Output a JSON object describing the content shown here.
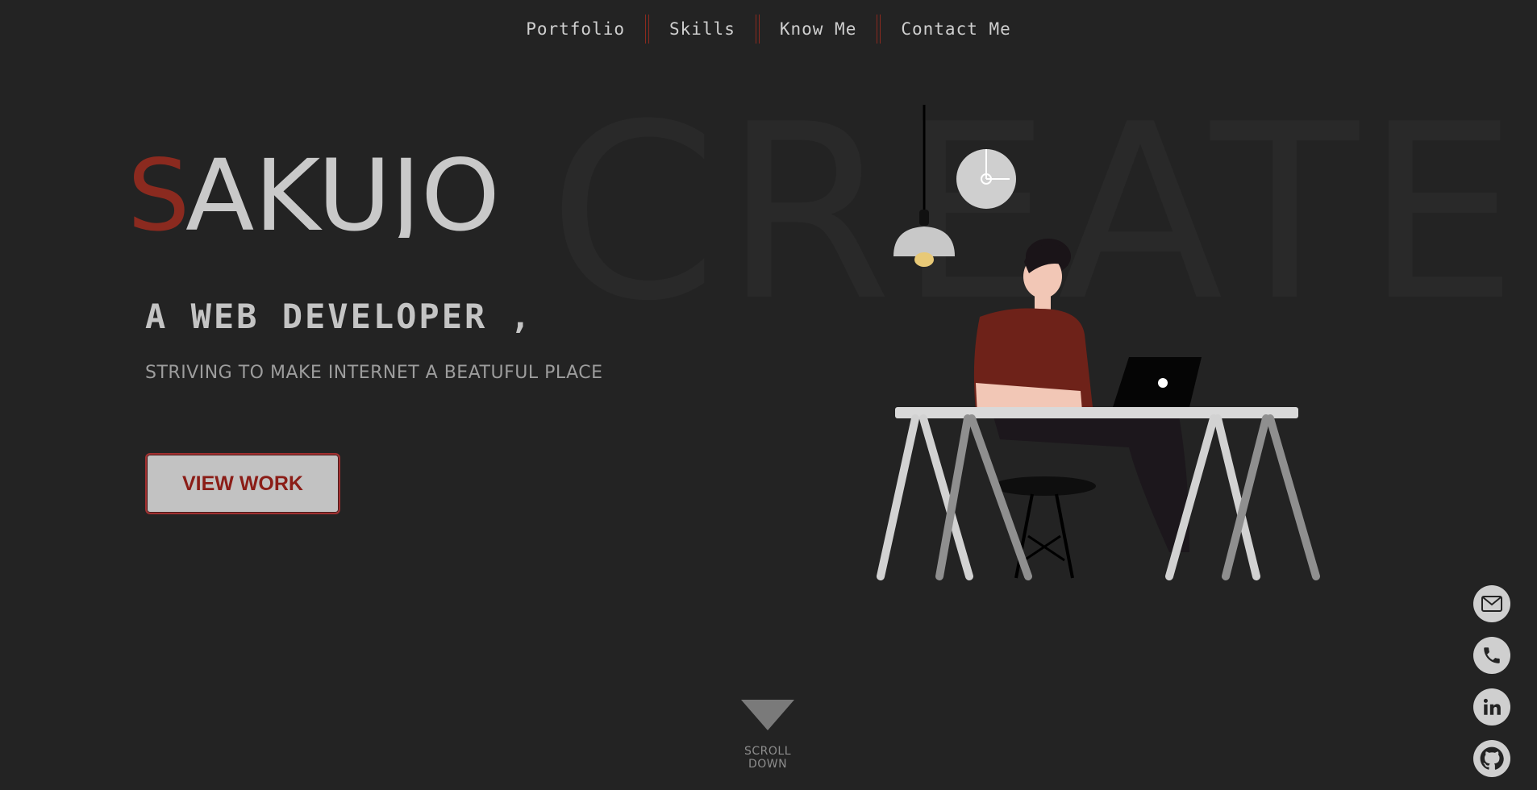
{
  "nav": {
    "items": [
      {
        "label": "Portfolio"
      },
      {
        "label": "Skills"
      },
      {
        "label": "Know Me"
      },
      {
        "label": "Contact Me"
      }
    ]
  },
  "hero": {
    "background_word": "CREATE",
    "logo": {
      "first_letter": "S",
      "rest": "AKUJO"
    },
    "headline": "A WEB DEVELOPER ,",
    "tagline": "STRIVING TO MAKE INTERNET A BEATUFUL PLACE",
    "cta_label": "VIEW WORK"
  },
  "scroll": {
    "label": "SCROLL DOWN"
  },
  "social": [
    {
      "icon": "mail-icon"
    },
    {
      "icon": "phone-icon"
    },
    {
      "icon": "linkedin-icon"
    },
    {
      "icon": "github-icon"
    }
  ],
  "colors": {
    "background": "#232323",
    "accent": "#8b2a1f",
    "text_light": "#c7c7c7"
  }
}
